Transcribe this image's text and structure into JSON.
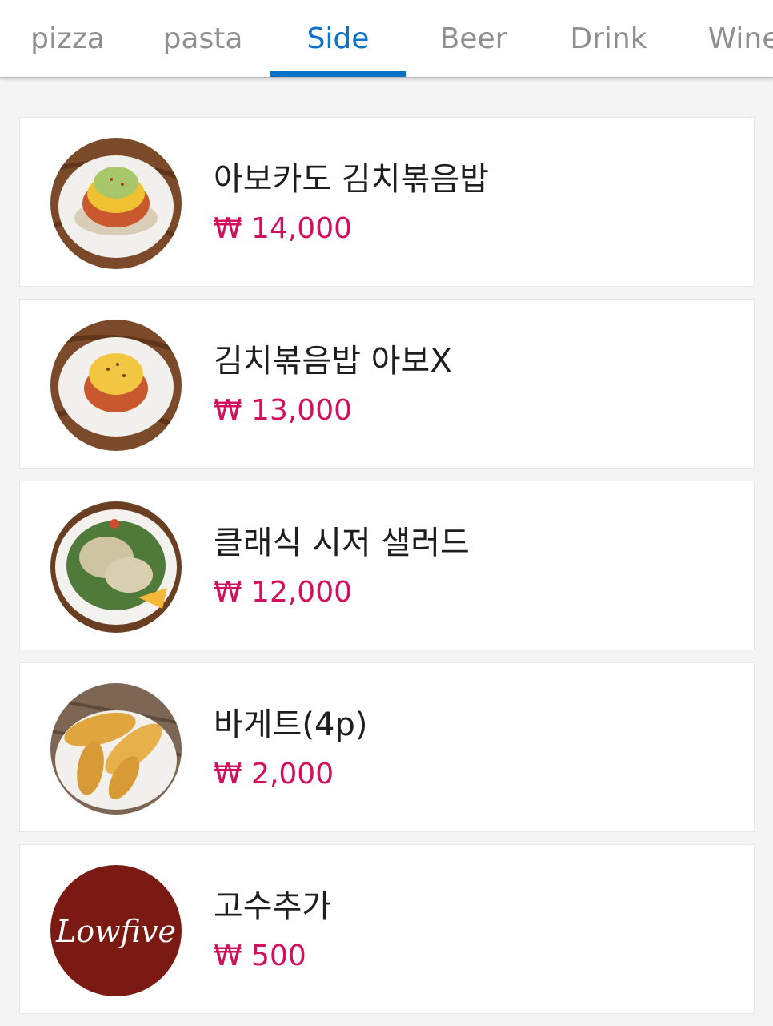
{
  "tabs": [
    {
      "label": "pizza",
      "active": false
    },
    {
      "label": "pasta",
      "active": false
    },
    {
      "label": "Side",
      "active": true
    },
    {
      "label": "Beer",
      "active": false
    },
    {
      "label": "Drink",
      "active": false
    },
    {
      "label": "Wine",
      "active": false
    }
  ],
  "colors": {
    "accent": "#0a72c8",
    "price": "#d3105e",
    "logo_bg": "#7a1a12"
  },
  "menu_items": [
    {
      "name": "아보카도 김치볶음밥",
      "price": "₩ 14,000",
      "image": "avocado-kimchi-fried-rice-photo"
    },
    {
      "name": "김치볶음밥 아보X",
      "price": "₩ 13,000",
      "image": "kimchi-fried-rice-photo"
    },
    {
      "name": "클래식 시저 샐러드",
      "price": "₩ 12,000",
      "image": "caesar-salad-photo"
    },
    {
      "name": "바게트(4p)",
      "price": "₩ 2,000",
      "image": "baguette-photo"
    },
    {
      "name": "고수추가",
      "price": "₩ 500",
      "image": "lowfive-logo",
      "logo_text": "Lowfive"
    }
  ]
}
